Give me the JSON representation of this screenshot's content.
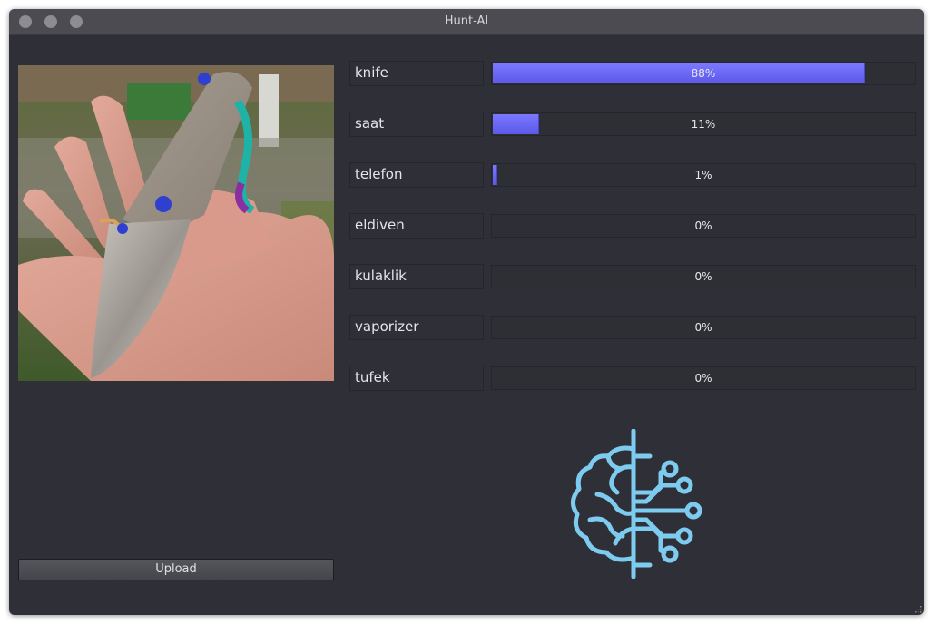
{
  "window": {
    "title": "Hunt-AI"
  },
  "upload": {
    "label": "Upload"
  },
  "predictions": [
    {
      "label": "knife",
      "percent_text": "88%",
      "value": 0.88
    },
    {
      "label": "saat",
      "percent_text": "11%",
      "value": 0.11
    },
    {
      "label": "telefon",
      "percent_text": "1%",
      "value": 0.01
    },
    {
      "label": "eldiven",
      "percent_text": "0%",
      "value": 0.0
    },
    {
      "label": "kulaklik",
      "percent_text": "0%",
      "value": 0.0
    },
    {
      "label": "vaporizer",
      "percent_text": "0%",
      "value": 0.0
    },
    {
      "label": "tufek",
      "percent_text": "0%",
      "value": 0.0
    }
  ],
  "colors": {
    "window_bg": "#2f3037",
    "bar_fill": "#6c69f5",
    "logo": "#7ecbf0"
  },
  "icons": {
    "logo": "brain-circuit-icon",
    "photo": "knife-in-hand-photo"
  }
}
